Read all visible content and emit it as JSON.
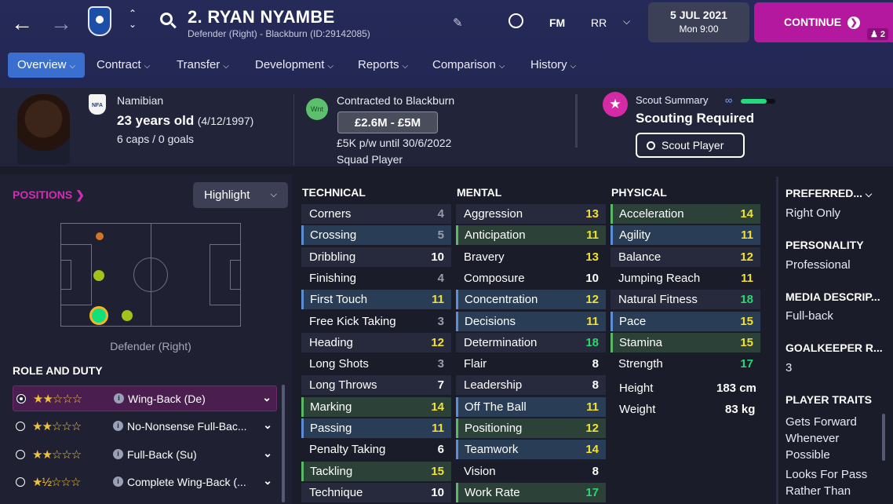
{
  "header": {
    "player_name": "2. RYAN NYAMBE",
    "subtitle": "Defender (Right) - Blackburn (ID:29142085)",
    "fm_label": "FM",
    "rr_label": "RR",
    "date": "5 JUL 2021",
    "time": "Mon 9:00",
    "continue_label": "CONTINUE",
    "continue_badge": "2"
  },
  "tabs": [
    {
      "label": "Overview"
    },
    {
      "label": "Contract"
    },
    {
      "label": "Transfer"
    },
    {
      "label": "Development"
    },
    {
      "label": "Reports"
    },
    {
      "label": "Comparison"
    },
    {
      "label": "History"
    }
  ],
  "profile": {
    "nationality": "Namibian",
    "nfa_badge": "NFA",
    "age": "23 years old",
    "dob": "(4/12/1997)",
    "caps": "6 caps / 0 goals",
    "wnt_badge": "Wnt",
    "contract": "Contracted to Blackburn",
    "value": "£2.6M - £5M",
    "wage": "£5K p/w until 30/6/2022",
    "squad_status": "Squad Player",
    "scout_summary_label": "Scout Summary",
    "scout_status": "Scouting Required",
    "scout_button": "Scout Player",
    "scout_progress": 0.75
  },
  "positions": {
    "title": "POSITIONS",
    "highlight_label": "Highlight",
    "position_name": "Defender (Right)"
  },
  "roles": {
    "title": "ROLE AND DUTY",
    "items": [
      {
        "name": "Wing-Back (De)",
        "stars": "★★☆☆☆"
      },
      {
        "name": "No-Nonsense Full-Bac...",
        "stars": "★★☆☆☆"
      },
      {
        "name": "Full-Back (Su)",
        "stars": "★★☆☆☆"
      },
      {
        "name": "Complete Wing-Back (...",
        "stars": "★½☆☆☆"
      }
    ]
  },
  "technical": {
    "title": "TECHNICAL",
    "attrs": [
      {
        "name": "Corners",
        "value": "4"
      },
      {
        "name": "Crossing",
        "value": "5"
      },
      {
        "name": "Dribbling",
        "value": "10"
      },
      {
        "name": "Finishing",
        "value": "4"
      },
      {
        "name": "First Touch",
        "value": "11"
      },
      {
        "name": "Free Kick Taking",
        "value": "3"
      },
      {
        "name": "Heading",
        "value": "12"
      },
      {
        "name": "Long Shots",
        "value": "3"
      },
      {
        "name": "Long Throws",
        "value": "7"
      },
      {
        "name": "Marking",
        "value": "14"
      },
      {
        "name": "Passing",
        "value": "11"
      },
      {
        "name": "Penalty Taking",
        "value": "6"
      },
      {
        "name": "Tackling",
        "value": "15"
      },
      {
        "name": "Technique",
        "value": "10"
      }
    ]
  },
  "mental": {
    "title": "MENTAL",
    "attrs": [
      {
        "name": "Aggression",
        "value": "13"
      },
      {
        "name": "Anticipation",
        "value": "11"
      },
      {
        "name": "Bravery",
        "value": "13"
      },
      {
        "name": "Composure",
        "value": "10"
      },
      {
        "name": "Concentration",
        "value": "12"
      },
      {
        "name": "Decisions",
        "value": "11"
      },
      {
        "name": "Determination",
        "value": "18"
      },
      {
        "name": "Flair",
        "value": "8"
      },
      {
        "name": "Leadership",
        "value": "8"
      },
      {
        "name": "Off The Ball",
        "value": "11"
      },
      {
        "name": "Positioning",
        "value": "12"
      },
      {
        "name": "Teamwork",
        "value": "14"
      },
      {
        "name": "Vision",
        "value": "8"
      },
      {
        "name": "Work Rate",
        "value": "17"
      }
    ]
  },
  "physical": {
    "title": "PHYSICAL",
    "attrs": [
      {
        "name": "Acceleration",
        "value": "14"
      },
      {
        "name": "Agility",
        "value": "11"
      },
      {
        "name": "Balance",
        "value": "12"
      },
      {
        "name": "Jumping Reach",
        "value": "11"
      },
      {
        "name": "Natural Fitness",
        "value": "18"
      },
      {
        "name": "Pace",
        "value": "15"
      },
      {
        "name": "Stamina",
        "value": "15"
      },
      {
        "name": "Strength",
        "value": "17"
      }
    ],
    "height_label": "Height",
    "height": "183 cm",
    "weight_label": "Weight",
    "weight": "83 kg"
  },
  "side": {
    "preferred_foot_title": "PREFERRED...",
    "preferred_foot": "Right Only",
    "personality_title": "PERSONALITY",
    "personality": "Professional",
    "media_title": "MEDIA DESCRIP...",
    "media": "Full-back",
    "gk_title": "GOALKEEPER R...",
    "gk": "3",
    "traits_title": "PLAYER TRAITS",
    "trait1": "Gets Forward Whenever Possible",
    "trait2": "Looks For Pass Rather Than"
  },
  "colors": {
    "accent": "#b4189f",
    "tab_active": "#3a6fd0",
    "value_low": "#9a9cad",
    "value_mid": "#ffffff",
    "value_good": "#f2e032",
    "value_high": "#27d96f"
  }
}
